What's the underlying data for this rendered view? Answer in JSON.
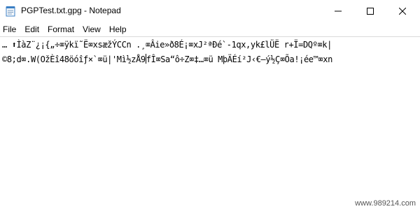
{
  "window": {
    "title": "PGPTest.txt.gpg - Notepad",
    "controls": [
      "minimize",
      "maximize",
      "close"
    ]
  },
  "menu": {
    "items": [
      "File",
      "Edit",
      "Format",
      "View",
      "Help"
    ]
  },
  "editor": {
    "line1": "… ⬆ÌàZ¨¿¡{„÷⌧ÿkï˜Ë⌧xsæžÝCCn .¸⌧Âie»ð8É¡⌧xJ²ªÐé`-1qx,yk£lÜË r+Ï=DQº⌧k|",
    "line2_before_caret": "©8;d⌧.W(OžÈî48öóîƒ×`⌧ü|'Mì½zÅ9",
    "line2_after_caret": "fÎ⌧Sa“ô÷Z⌧‡…⌧ü MþÄÉí²J‹€—ý½Ç⌧Õa!¡ée™⌧xn"
  },
  "watermark": "www.989214.com"
}
